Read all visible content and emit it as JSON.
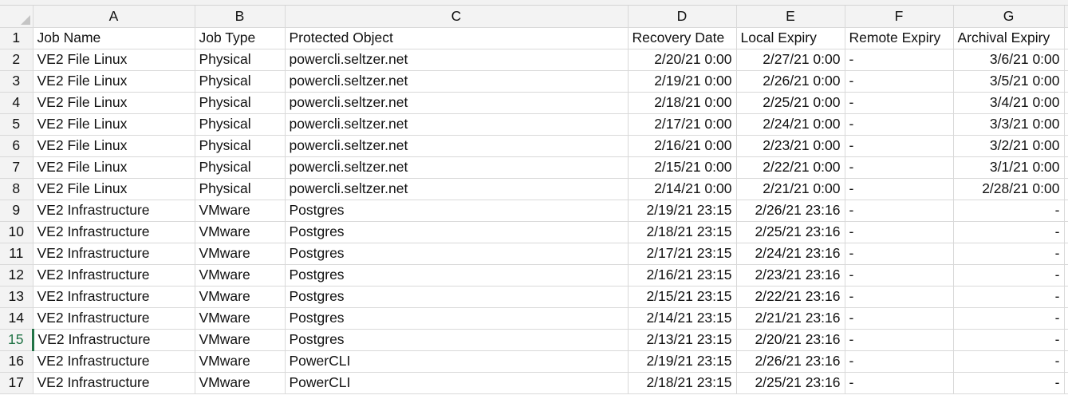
{
  "columns": [
    "A",
    "B",
    "C",
    "D",
    "E",
    "F",
    "G"
  ],
  "active_row": 15,
  "rows": [
    {
      "n": "1",
      "cells": [
        "Job Name",
        "Job Type",
        "Protected Object",
        "Recovery Date",
        "Local Expiry",
        "Remote Expiry",
        "Archival Expiry"
      ]
    },
    {
      "n": "2",
      "cells": [
        "VE2 File Linux",
        "Physical",
        "powercli.seltzer.net",
        "2/20/21 0:00",
        "2/27/21 0:00",
        "-",
        "3/6/21 0:00"
      ]
    },
    {
      "n": "3",
      "cells": [
        "VE2 File Linux",
        "Physical",
        "powercli.seltzer.net",
        "2/19/21 0:00",
        "2/26/21 0:00",
        "-",
        "3/5/21 0:00"
      ]
    },
    {
      "n": "4",
      "cells": [
        "VE2 File Linux",
        "Physical",
        "powercli.seltzer.net",
        "2/18/21 0:00",
        "2/25/21 0:00",
        "-",
        "3/4/21 0:00"
      ]
    },
    {
      "n": "5",
      "cells": [
        "VE2 File Linux",
        "Physical",
        "powercli.seltzer.net",
        "2/17/21 0:00",
        "2/24/21 0:00",
        "-",
        "3/3/21 0:00"
      ]
    },
    {
      "n": "6",
      "cells": [
        "VE2 File Linux",
        "Physical",
        "powercli.seltzer.net",
        "2/16/21 0:00",
        "2/23/21 0:00",
        "-",
        "3/2/21 0:00"
      ]
    },
    {
      "n": "7",
      "cells": [
        "VE2 File Linux",
        "Physical",
        "powercli.seltzer.net",
        "2/15/21 0:00",
        "2/22/21 0:00",
        "-",
        "3/1/21 0:00"
      ]
    },
    {
      "n": "8",
      "cells": [
        "VE2 File Linux",
        "Physical",
        "powercli.seltzer.net",
        "2/14/21 0:00",
        "2/21/21 0:00",
        "-",
        "2/28/21 0:00"
      ]
    },
    {
      "n": "9",
      "cells": [
        "VE2 Infrastructure",
        "VMware",
        "Postgres",
        "2/19/21 23:15",
        "2/26/21 23:16",
        "-",
        "-"
      ]
    },
    {
      "n": "10",
      "cells": [
        "VE2 Infrastructure",
        "VMware",
        "Postgres",
        "2/18/21 23:15",
        "2/25/21 23:16",
        "-",
        "-"
      ]
    },
    {
      "n": "11",
      "cells": [
        "VE2 Infrastructure",
        "VMware",
        "Postgres",
        "2/17/21 23:15",
        "2/24/21 23:16",
        "-",
        "-"
      ]
    },
    {
      "n": "12",
      "cells": [
        "VE2 Infrastructure",
        "VMware",
        "Postgres",
        "2/16/21 23:15",
        "2/23/21 23:16",
        "-",
        "-"
      ]
    },
    {
      "n": "13",
      "cells": [
        "VE2 Infrastructure",
        "VMware",
        "Postgres",
        "2/15/21 23:15",
        "2/22/21 23:16",
        "-",
        "-"
      ]
    },
    {
      "n": "14",
      "cells": [
        "VE2 Infrastructure",
        "VMware",
        "Postgres",
        "2/14/21 23:15",
        "2/21/21 23:16",
        "-",
        "-"
      ]
    },
    {
      "n": "15",
      "cells": [
        "VE2 Infrastructure",
        "VMware",
        "Postgres",
        "2/13/21 23:15",
        "2/20/21 23:16",
        "-",
        "-"
      ]
    },
    {
      "n": "16",
      "cells": [
        "VE2 Infrastructure",
        "VMware",
        "PowerCLI",
        "2/19/21 23:15",
        "2/26/21 23:16",
        "-",
        "-"
      ]
    },
    {
      "n": "17",
      "cells": [
        "VE2 Infrastructure",
        "VMware",
        "PowerCLI",
        "2/18/21 23:15",
        "2/25/21 23:16",
        "-",
        "-"
      ]
    }
  ]
}
